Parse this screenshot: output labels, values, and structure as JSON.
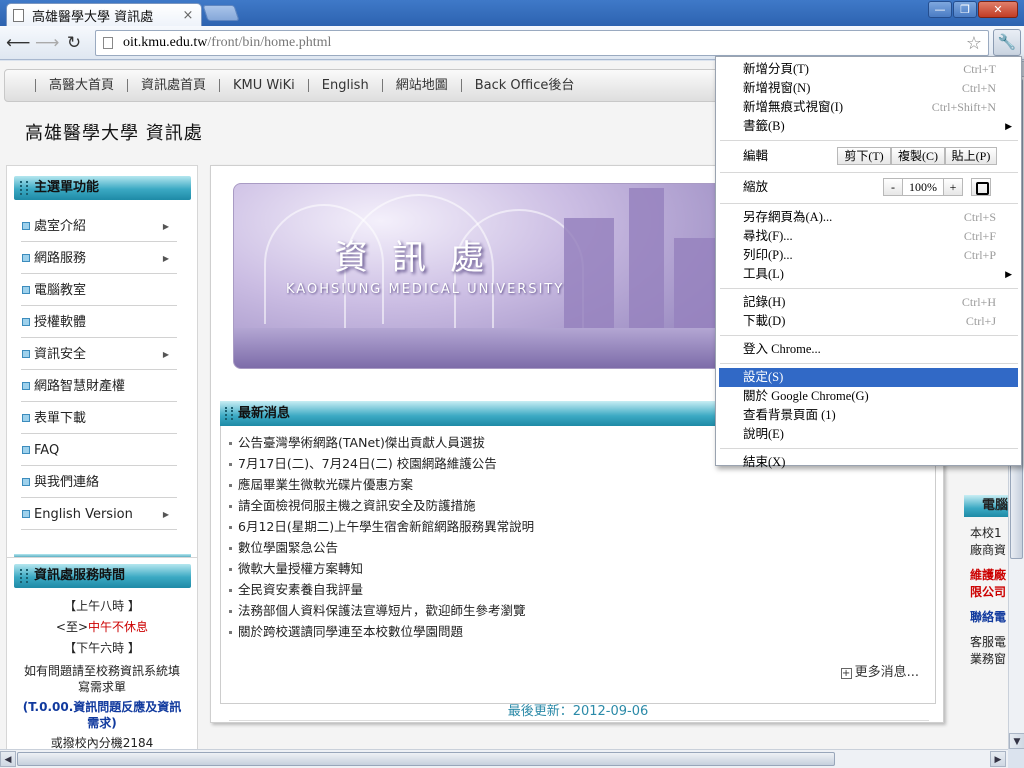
{
  "browser": {
    "tab_title": "高雄醫學大學 資訊處",
    "tab_close": "×",
    "url_host": "oit.kmu.edu.tw",
    "url_path": "/front/bin/home.phtml",
    "win_min": "—",
    "win_max": "❐",
    "win_close": "✕"
  },
  "site_nav": [
    "高醫大首頁",
    "資訊處首頁",
    "KMU WiKi",
    "English",
    "網站地圖",
    "Back Office後台"
  ],
  "site_title": "高雄醫學大學 資訊處",
  "main_menu": {
    "title": "主選單功能",
    "items": [
      {
        "label": "處室介紹",
        "has_sub": true
      },
      {
        "label": "網路服務",
        "has_sub": true
      },
      {
        "label": "電腦教室",
        "has_sub": false
      },
      {
        "label": "授權軟體",
        "has_sub": false
      },
      {
        "label": "資訊安全",
        "has_sub": true
      },
      {
        "label": "網路智慧財產權",
        "has_sub": false
      },
      {
        "label": "表單下載",
        "has_sub": false
      },
      {
        "label": "FAQ",
        "has_sub": false
      },
      {
        "label": "與我們連絡",
        "has_sub": false
      },
      {
        "label": "English Version",
        "has_sub": true
      }
    ]
  },
  "hours": {
    "title": "資訊處服務時間",
    "line1": "【上午八時 】",
    "line2_prefix": "<至>",
    "line2_red": "中午不休息",
    "line3": "【下午六時 】",
    "note": "如有問題請至校務資訊系統填寫需求單",
    "link": "(T.0.00.資訊問題反應及資訊需求)",
    "cutoff": "或撥校內分機2184"
  },
  "banner": {
    "title": "資訊處",
    "subtitle": "KAOHSIUNG MEDICAL UNIVERSITY"
  },
  "news": {
    "title": "最新消息",
    "items": [
      "公告臺灣學術網路(TANet)傑出貢獻人員選拔",
      "7月17日(二)、7月24日(二) 校園網路維護公告",
      "應屆畢業生微軟光碟片優惠方案",
      "請全面檢視伺服主機之資訊安全及防護措施",
      "6月12日(星期二)上午學生宿舍新館網路服務異常說明",
      "數位學園緊急公告",
      "微軟大量授權方案轉知",
      "全民資安素養自我評量",
      "法務部個人資料保護法宣導短片，歡迎師生參考瀏覽",
      "關於跨校選讀同學連至本校數位學園問題"
    ],
    "more": "更多消息...",
    "last_update": "最後更新：2012-09-06"
  },
  "right_col": {
    "head": "電腦",
    "body1": "本校1",
    "body2": "廠商資",
    "red1": "維護廠",
    "red2": "限公司",
    "blue1": "聯絡電",
    "body3": "客服電",
    "body4": "業務窗"
  },
  "chrome_menu": {
    "items": [
      {
        "label": "新增分頁(T)",
        "shortcut": "Ctrl+T"
      },
      {
        "label": "新增視窗(N)",
        "shortcut": "Ctrl+N"
      },
      {
        "label": "新增無痕式視窗(I)",
        "shortcut": "Ctrl+Shift+N"
      },
      {
        "label": "書籤(B)",
        "shortcut": ""
      }
    ],
    "edit": {
      "label": "編輯",
      "cut": "剪下(T)",
      "copy": "複製(C)",
      "paste": "貼上(P)"
    },
    "zoom": {
      "label": "縮放",
      "minus": "-",
      "value": "100%",
      "plus": "+"
    },
    "items2": [
      {
        "label": "另存網頁為(A)...",
        "shortcut": "Ctrl+S"
      },
      {
        "label": "尋找(F)...",
        "shortcut": "Ctrl+F"
      },
      {
        "label": "列印(P)...",
        "shortcut": "Ctrl+P"
      },
      {
        "label": "工具(L)",
        "shortcut": ""
      }
    ],
    "items3": [
      {
        "label": "記錄(H)",
        "shortcut": "Ctrl+H"
      },
      {
        "label": "下載(D)",
        "shortcut": "Ctrl+J"
      }
    ],
    "signin": "登入 Chrome...",
    "items4": [
      {
        "label": "設定(S)"
      },
      {
        "label": "關於 Google Chrome(G)"
      },
      {
        "label": "查看背景頁面 (1)"
      },
      {
        "label": "說明(E)"
      }
    ],
    "exit": "結束(X)"
  },
  "colors": {
    "accent_teal": "#3ba9c3",
    "menu_highlight": "#3169c6",
    "update_text": "#2b8aa8",
    "titlebar": "#3f79c8"
  }
}
